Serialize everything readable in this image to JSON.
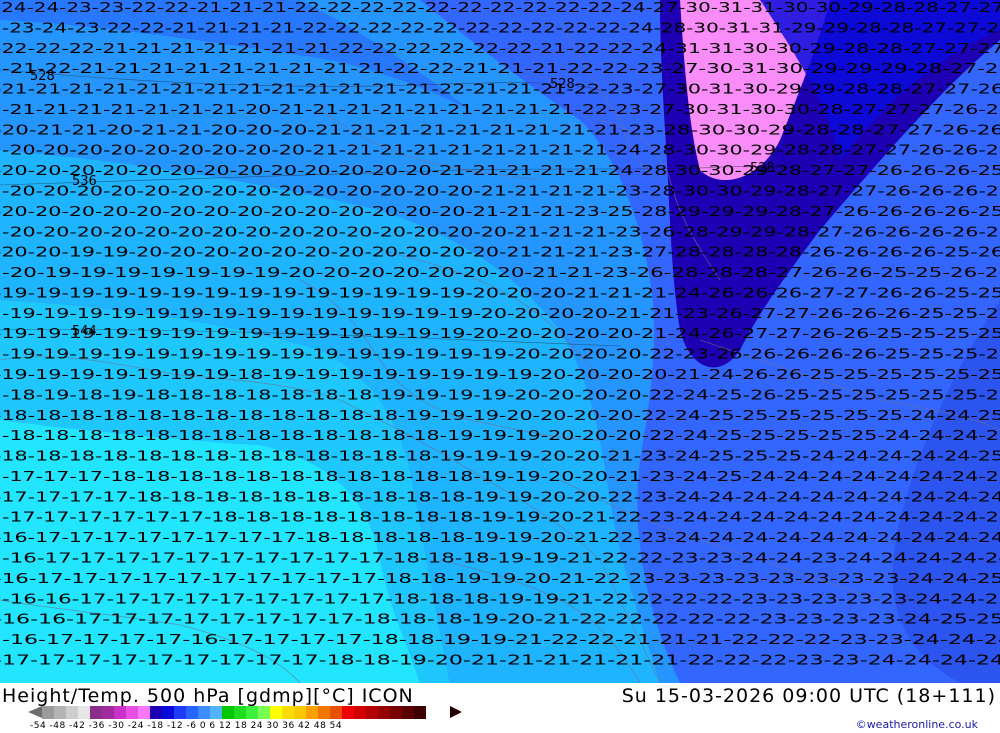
{
  "title": {
    "left": "Height/Temp. 500 hPa [gdmp][°C] ICON",
    "right": "Su 15-03-2026 09:00 UTC (18+111)"
  },
  "credit": "©weatheronline.co.uk",
  "legend": {
    "ticks_label": "-54 -48 -42 -36 -30 -24 -18 -12 -6  0  6  12  18  24  30  36  42  48  54",
    "colors": [
      "#9b9b9b",
      "#b4b4b4",
      "#cdcdcd",
      "#e6e6e6",
      "#8b2d8b",
      "#a02aa0",
      "#c832c8",
      "#e650e6",
      "#fa78fa",
      "#1e00b4",
      "#0a0adc",
      "#1e3cf5",
      "#2864ff",
      "#3c8cff",
      "#50b4ff",
      "#00c800",
      "#1edc1e",
      "#3cf03c",
      "#78ff50",
      "#ffff00",
      "#fadc00",
      "#fac800",
      "#faa000",
      "#f07800",
      "#e65000",
      "#f00000",
      "#d20000",
      "#b40000",
      "#960000",
      "#780000",
      "#5a0000",
      "#3c0000"
    ]
  },
  "map": {
    "contour_labels": [
      "-24",
      "-23",
      "-22",
      "-21",
      "-20",
      "-19",
      "-18",
      "-17",
      "-16",
      "-25",
      "-26",
      "-27",
      "-28",
      "-29",
      "-30",
      "-31",
      "528",
      "536",
      "544"
    ],
    "rows": [
      "-24-24-23-23-22-22-21-21-21-22-22-22-22-22-22-22-22-22-22-24-27-30-31-31-30-30-29-28-28-27-27",
      "-23-24-23-22-22-21-21-21-21-22-22-22-22-22-22-22-22-22-22-24-28-30-31-31-29-29-28-28-27-27-27",
      "-22-22-22-21-21-21-21-21-21-21-22-22-22-22-22-22-21-22-22-24-31-31-30-30-29-28-28-27-27-27",
      "-21-22-21-21-21-21-21-21-21-21-21-22-22-21-21-21-22-22-23-27-30-31-30-29-29-29-28-27-27",
      "-21-21-21-21-21-21-21-21-21-21-21-21-21-22-21-21-21-22-23-27-30-31-30-29-29-28-28-27-27-26",
      "-21-21-21-21-21-21-21-20-21-21-21-21-21-21-21-21-21-22-23-27-30-31-30-30-28-27-27-27-26-26",
      "-20-21-21-20-21-21-20-20-20-21-21-21-21-21-21-21-21-21-23-28-30-30-29-28-28-27-27-26-26",
      "-20-20-20-20-20-20-20-20-20-21-21-21-21-21-21-21-21-21-24-28-30-30-29-28-28-27-27-26-26-26",
      "-20-20-20-20-20-20-20-20-20-20-20-20-20-21-21-21-21-21-24-28-30-30-29-28-27-27-26-26-26-25",
      "-20-20-20-20-20-20-20-20-20-20-20-20-20-20-21-21-21-21-23-28-30-30-29-28-27-27-26-26-26-25",
      "-20-20-20-20-20-20-20-20-20-20-20-20-20-20-21-21-21-23-25-28-29-29-29-28-27-26-26-26-26-25",
      "-20-20-20-20-20-20-20-20-20-20-20-20-20-20-20-21-21-21-23-26-28-29-29-28-27-26-26-26-26-25",
      "-20-20-19-19-20-20-20-20-20-20-20-20-20-20-20-21-21-21-23-27-28-28-28-28-26-26-26-26-25-26",
      "-20-19-19-19-19-19-19-19-20-20-20-20-20-20-20-21-21-23-26-28-28-28-27-26-26-25-25-26-26",
      "-19-19-19-19-19-19-19-19-19-19-19-19-19-19-20-20-20-21-21-21-24-26-26-26-27-27-26-26-25-25",
      "-19-19-19-19-19-19-19-19-19-19-19-19-19-19-20-20-20-20-21-21-23-26-27-27-26-26-26-25-25-25",
      "-19-19-19-19-19-19-19-19-19-19-19-19-19-19-20-20-20-20-20-21-24-26-27-27-26-26-25-25-25-25",
      "-19-19-19-19-19-19-19-19-19-19-19-19-19-19-19-20-20-20-20-22-23-26-26-26-26-26-25-25-25-25",
      "-19-19-19-19-19-19-19-18-19-19-19-19-19-19-19-19-20-20-20-20-21-24-26-26-25-25-25-25-25-25",
      "-18-19-18-19-18-18-18-18-18-18-18-19-19-19-19-20-20-20-20-22-24-25-26-25-25-25-25-25-25-25",
      "-18-18-18-18-18-18-18-18-18-18-18-18-19-19-19-20-20-20-20-22-24-25-25-25-25-25-25-24-24-25",
      "-18-18-18-18-18-18-18-18-18-18-18-18-18-19-19-19-20-20-20-22-24-25-25-25-25-25-24-24-24-25",
      "-18-18-18-18-18-18-18-18-18-18-18-18-18-19-19-19-20-20-21-23-24-25-25-25-24-24-24-24-24-25",
      "-17-17-17-18-18-18-18-18-18-18-18-18-18-18-19-19-20-20-21-23-24-25-24-24-24-24-24-24-24-24",
      "-17-17-17-17-18-18-18-18-18-18-18-18-18-18-19-19-20-20-22-23-24-24-24-24-24-24-24-24-24-24",
      "-17-17-17-17-17-17-18-18-18-18-18-18-18-18-19-19-20-21-22-23-24-24-24-24-24-24-24-24-24-24",
      "-16-17-17-17-17-17-17-17-17-18-18-18-18-18-19-19-20-21-22-23-24-24-24-24-24-24-24-24-24-24",
      "-16-17-17-17-17-17-17-17-17-17-17-18-18-18-19-19-21-22-22-23-23-24-24-23-24-24-24-24-24",
      "-16-17-17-17-17-17-17-17-17-17-17-18-18-19-19-20-21-22-23-23-23-23-23-23-23-23-24-24-25",
      "-16-16-17-17-17-17-17-17-17-17-17-18-18-18-19-19-21-22-22-22-22-23-23-23-23-23-24-24-25",
      "-16-16-17-17-17-17-17-17-17-17-18-18-18-19-20-21-22-22-22-22-22-23-23-23-23-24-25-25",
      "-16-17-17-17-17-16-17-17-17-17-18-18-19-19-21-22-22-21-21-21-22-22-22-23-23-24-24-24",
      "-17-17-17-17-17-17-17-17-17-18-18-19-20-21-21-21-21-21-21-22-22-22-23-23-24-24-24-24"
    ],
    "height_labels": [
      "528",
      "536",
      "544"
    ]
  }
}
